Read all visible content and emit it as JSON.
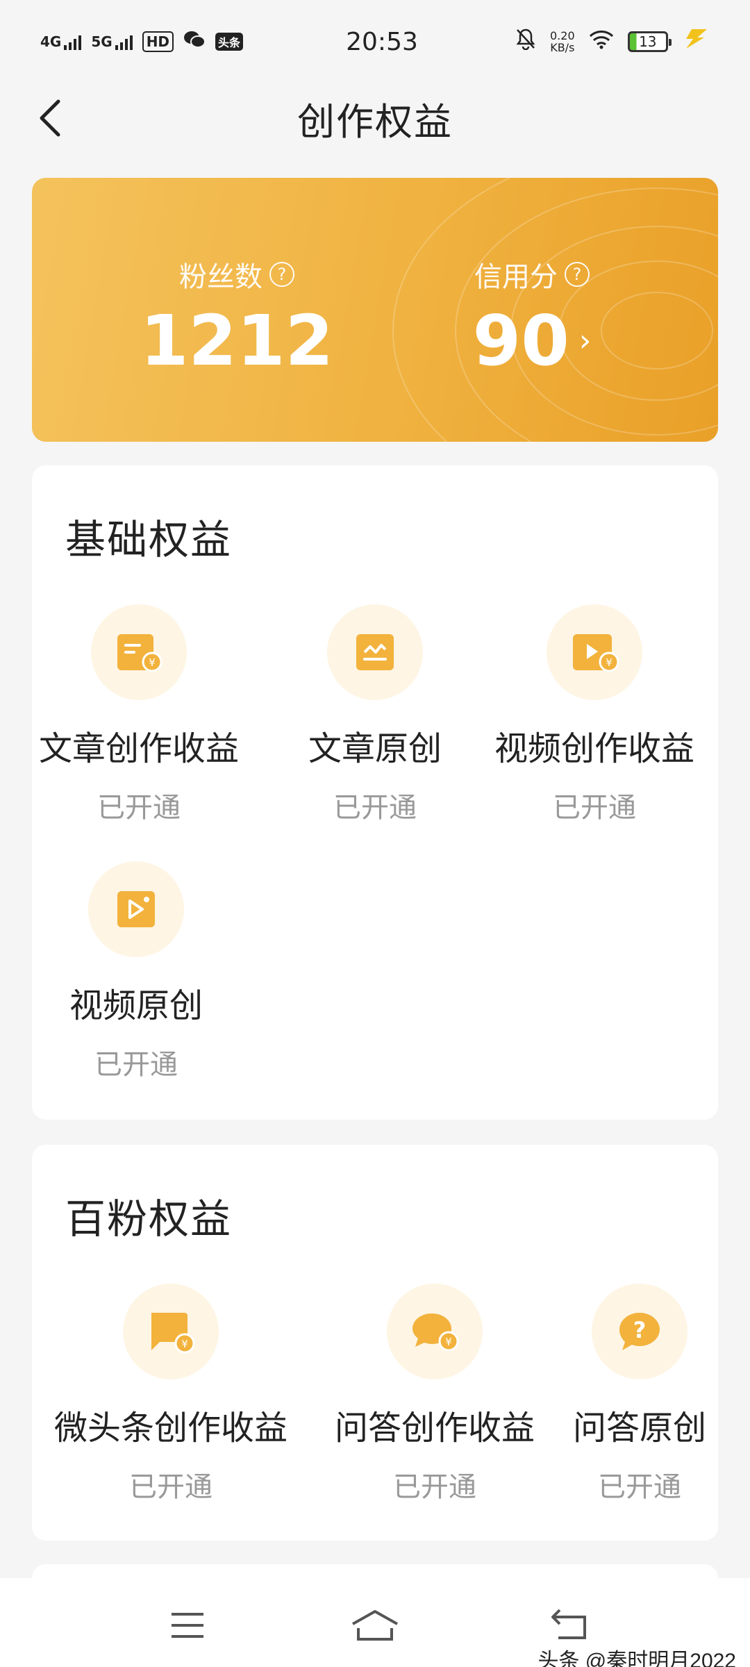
{
  "status_bar": {
    "net1": "4G",
    "net2": "5G",
    "hd": "HD",
    "toutiao_badge": "头条",
    "time": "20:53",
    "net_speed_value": "0.20",
    "net_speed_unit": "KB/s",
    "battery": "13"
  },
  "nav": {
    "title": "创作权益"
  },
  "stats": {
    "fans_label": "粉丝数",
    "fans_value": "1212",
    "credit_label": "信用分",
    "credit_value": "90"
  },
  "basic": {
    "title": "基础权益",
    "items": [
      {
        "name": "文章创作收益",
        "status": "已开通",
        "icon": "article-income-icon"
      },
      {
        "name": "文章原创",
        "status": "已开通",
        "icon": "article-original-icon"
      },
      {
        "name": "视频创作收益",
        "status": "已开通",
        "icon": "video-income-icon"
      },
      {
        "name": "视频原创",
        "status": "已开通",
        "icon": "video-original-icon"
      }
    ]
  },
  "hundred": {
    "title": "百粉权益",
    "items": [
      {
        "name": "微头条创作收益",
        "status": "已开通",
        "icon": "micro-toutiao-income-icon"
      },
      {
        "name": "问答创作收益",
        "status": "已开通",
        "icon": "qa-income-icon"
      },
      {
        "name": "问答原创",
        "status": "已开通",
        "icon": "qa-original-icon"
      }
    ]
  },
  "watermark": "头条 @秦时明月2022",
  "colors": {
    "accent": "#f0b240",
    "icon_bg": "#fef5e4",
    "icon_fill": "#f2b23c"
  }
}
